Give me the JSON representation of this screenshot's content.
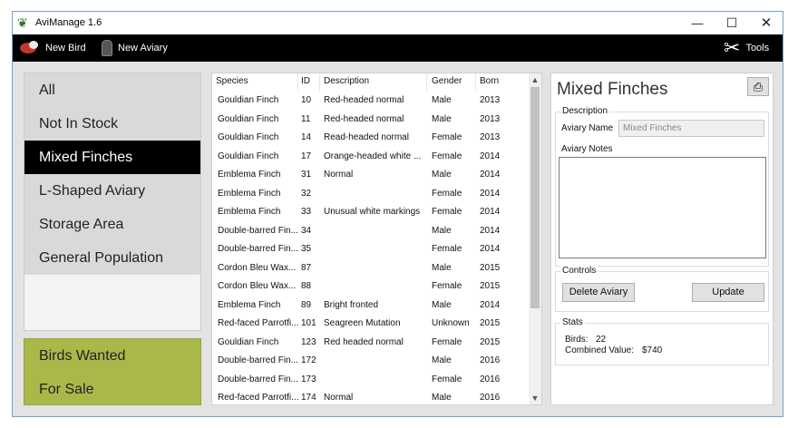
{
  "window": {
    "title": "AviManage 1.6"
  },
  "toolbar": {
    "new_bird": "New Bird",
    "new_aviary": "New Aviary",
    "tools": "Tools"
  },
  "aviaries": [
    "All",
    "Not In Stock",
    "Mixed Finches",
    "L-Shaped Aviary",
    "Storage Area",
    "General Population"
  ],
  "special": [
    "Birds Wanted",
    "For Sale"
  ],
  "table": {
    "columns": [
      "Species",
      "ID",
      "Description",
      "Gender",
      "Born"
    ],
    "rows": [
      [
        "Gouldian Finch",
        "10",
        "Red-headed normal",
        "Male",
        "2013"
      ],
      [
        "Gouldian Finch",
        "11",
        "Red-headed normal",
        "Male",
        "2013"
      ],
      [
        "Gouldian Finch",
        "14",
        "Read-headed normal",
        "Female",
        "2013"
      ],
      [
        "Gouldian Finch",
        "17",
        "Orange-headed white ...",
        "Female",
        "2014"
      ],
      [
        "Emblema Finch",
        "31",
        "Normal",
        "Male",
        "2014"
      ],
      [
        "Emblema Finch",
        "32",
        "",
        "Female",
        "2014"
      ],
      [
        "Emblema Finch",
        "33",
        "Unusual white markings",
        "Female",
        "2014"
      ],
      [
        "Double-barred Fin...",
        "34",
        "",
        "Male",
        "2014"
      ],
      [
        "Double-barred Fin...",
        "35",
        "",
        "Female",
        "2014"
      ],
      [
        "Cordon Bleu Wax...",
        "87",
        "",
        "Male",
        "2015"
      ],
      [
        "Cordon Bleu Wax...",
        "88",
        "",
        "Female",
        "2015"
      ],
      [
        "Emblema Finch",
        "89",
        "Bright fronted",
        "Male",
        "2014"
      ],
      [
        "Red-faced Parrotfi...",
        "101",
        "Seagreen Mutation",
        "Unknown",
        "2015"
      ],
      [
        "Gouldian Finch",
        "123",
        "Red headed normal",
        "Female",
        "2015"
      ],
      [
        "Double-barred Fin...",
        "172",
        "",
        "Male",
        "2016"
      ],
      [
        "Double-barred Fin...",
        "173",
        "",
        "Female",
        "2016"
      ],
      [
        "Red-faced Parrotfi...",
        "174",
        "Normal",
        "Male",
        "2016"
      ]
    ]
  },
  "details": {
    "title": "Mixed Finches",
    "description_legend": "Description",
    "aviary_name_label": "Aviary Name",
    "aviary_name_value": "Mixed Finches",
    "aviary_notes_label": "Aviary Notes",
    "controls_legend": "Controls",
    "delete_button": "Delete Aviary",
    "update_button": "Update",
    "stats_legend": "Stats",
    "birds_label": "Birds:",
    "birds_value": "22",
    "value_label": "Combined Value:",
    "value_value": "$740"
  },
  "colors": {
    "selected_aviary": "#000000",
    "special_list": "#aab84a",
    "toolbar": "#000000"
  }
}
